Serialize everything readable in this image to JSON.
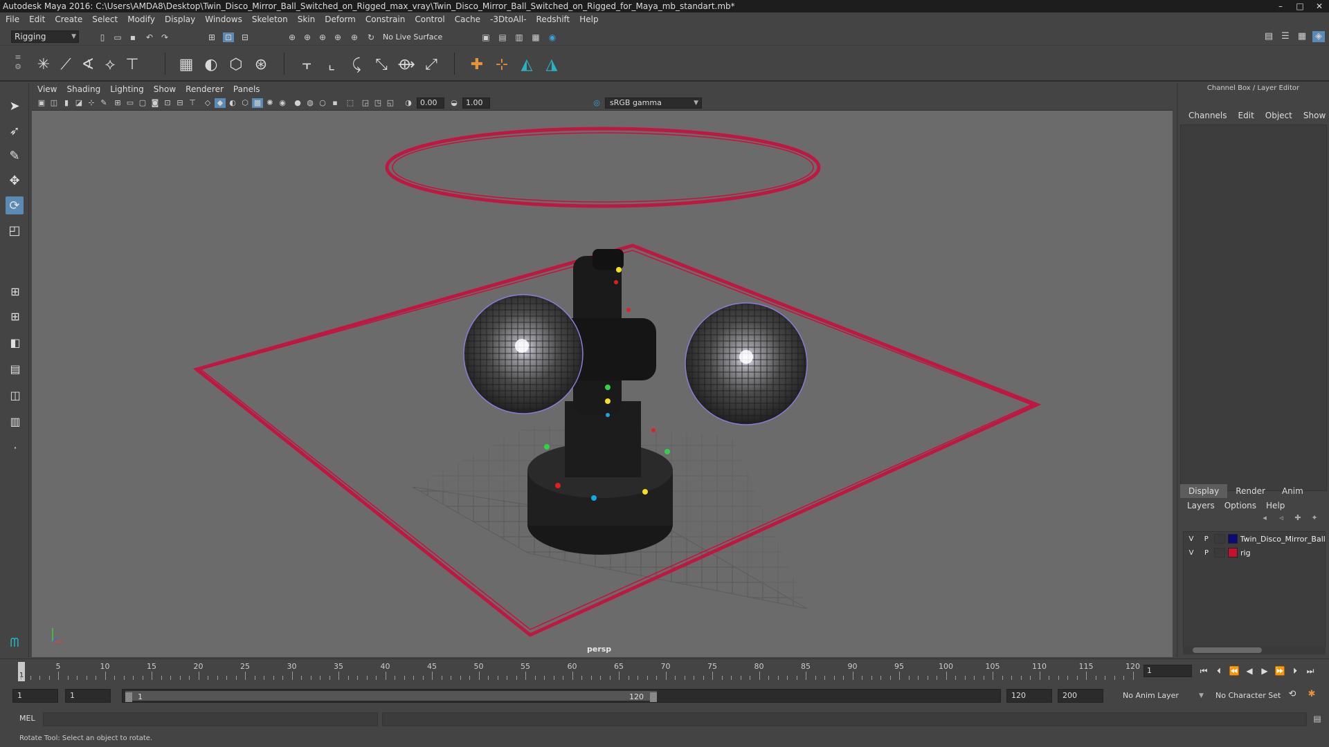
{
  "window": {
    "title": "Autodesk Maya 2016: C:\\Users\\AMDA8\\Desktop\\Twin_Disco_Mirror_Ball_Switched_on_Rigged_max_vray\\Twin_Disco_Mirror_Ball_Switched_on_Rigged_for_Maya_mb_standart.mb*",
    "minimize": "–",
    "maximize": "□",
    "close": "✕"
  },
  "menubar": {
    "items": [
      "File",
      "Edit",
      "Create",
      "Select",
      "Modify",
      "Display",
      "Windows",
      "Skeleton",
      "Skin",
      "Deform",
      "Constrain",
      "Control",
      "Cache",
      "-3DtoAll-",
      "Redshift",
      "Help"
    ]
  },
  "statusline": {
    "mode": "Rigging",
    "live_surface": "No Live Surface"
  },
  "viewport": {
    "menu": [
      "View",
      "Shading",
      "Lighting",
      "Show",
      "Renderer",
      "Panels"
    ],
    "exposure": "0.00",
    "gamma": "1.00",
    "color_space": "sRGB gamma",
    "camera_label": "persp"
  },
  "right_panel": {
    "title": "Channel Box / Layer Editor",
    "channel_tabs": [
      "Channels",
      "Edit",
      "Object",
      "Show"
    ],
    "layer_tabs": [
      "Display",
      "Render",
      "Anim"
    ],
    "active_layer_tab": "Display",
    "layer_menu": [
      "Layers",
      "Options",
      "Help"
    ],
    "layers": [
      {
        "v": "V",
        "p": "P",
        "name": "Twin_Disco_Mirror_Ball",
        "color": "#0a0a7a"
      },
      {
        "v": "V",
        "p": "P",
        "name": "rig",
        "color": "#c8102e"
      }
    ]
  },
  "timeline": {
    "ticks": [
      5,
      10,
      15,
      20,
      25,
      30,
      35,
      40,
      45,
      50,
      55,
      60,
      65,
      70,
      75,
      80,
      85,
      90,
      95,
      100,
      105,
      110,
      115,
      120
    ],
    "current_frame": "1",
    "frame_field": "1"
  },
  "rangebar": {
    "start_time": "1",
    "playback_start": "1",
    "range_start_label": "1",
    "range_end_label": "120",
    "playback_end": "120",
    "end_time": "200",
    "anim_layer": "No Anim Layer",
    "character_set": "No Character Set"
  },
  "cmdline": {
    "label": "MEL"
  },
  "helpline": {
    "text": "Rotate Tool: Select an object to rotate."
  },
  "colors": {
    "rig_curve": "#c8103e",
    "viewport_bg": "#6b6b6b",
    "active_tool": "#5b8ab5"
  }
}
